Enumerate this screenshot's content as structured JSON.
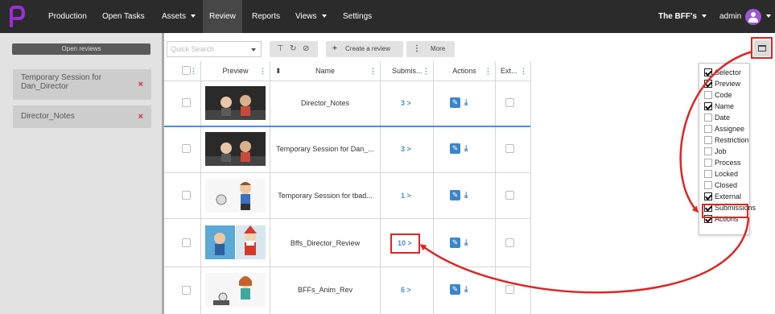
{
  "topbar": {
    "logo_text": "p",
    "nav": [
      {
        "label": "Production"
      },
      {
        "label": "Open Tasks"
      },
      {
        "label": "Assets"
      },
      {
        "label": "Review"
      },
      {
        "label": "Reports"
      },
      {
        "label": "Views"
      },
      {
        "label": "Settings"
      }
    ],
    "project": "The BFF's",
    "user": "admin"
  },
  "sidebar": {
    "open_reviews": "Open reviews",
    "sessions": [
      {
        "label": "Temporary Session for Dan_Director"
      },
      {
        "label": "Director_Notes"
      }
    ],
    "remove_glyph": "×"
  },
  "toolbar": {
    "search_placeholder": "Quick Search",
    "create_label": "Create a review",
    "more_label": "More"
  },
  "table": {
    "headers": {
      "preview": "Preview",
      "name": "Name",
      "submissions": "Submis...",
      "actions": "Actions",
      "external": "Ext..."
    },
    "rows": [
      {
        "name": "Director_Notes",
        "submissions": "3 >"
      },
      {
        "name": "Temporary Session for Dan_...",
        "submissions": "3 >"
      },
      {
        "name": "Temporary Session for tbad...",
        "submissions": "1 >"
      },
      {
        "name": "Bffs_Director_Review",
        "submissions": "10 >"
      },
      {
        "name": "BFFs_Anim_Rev",
        "submissions": "6 >"
      }
    ]
  },
  "column_menu": {
    "options": [
      {
        "label": "Selector",
        "checked": true
      },
      {
        "label": "Preview",
        "checked": true
      },
      {
        "label": "Code",
        "checked": false
      },
      {
        "label": "Name",
        "checked": true
      },
      {
        "label": "Date",
        "checked": false
      },
      {
        "label": "Assignee",
        "checked": false
      },
      {
        "label": "Restriction",
        "checked": false
      },
      {
        "label": "Job",
        "checked": false
      },
      {
        "label": "Process",
        "checked": false
      },
      {
        "label": "Locked",
        "checked": false
      },
      {
        "label": "Closed",
        "checked": false
      },
      {
        "label": "External",
        "checked": true
      },
      {
        "label": "Submissions",
        "checked": true
      },
      {
        "label": "Actions",
        "checked": true
      }
    ]
  },
  "colors": {
    "topbar": "#2b2b2b",
    "accent": "#4a90d9",
    "callout": "#e02424",
    "logo": "#9b2fd6"
  }
}
